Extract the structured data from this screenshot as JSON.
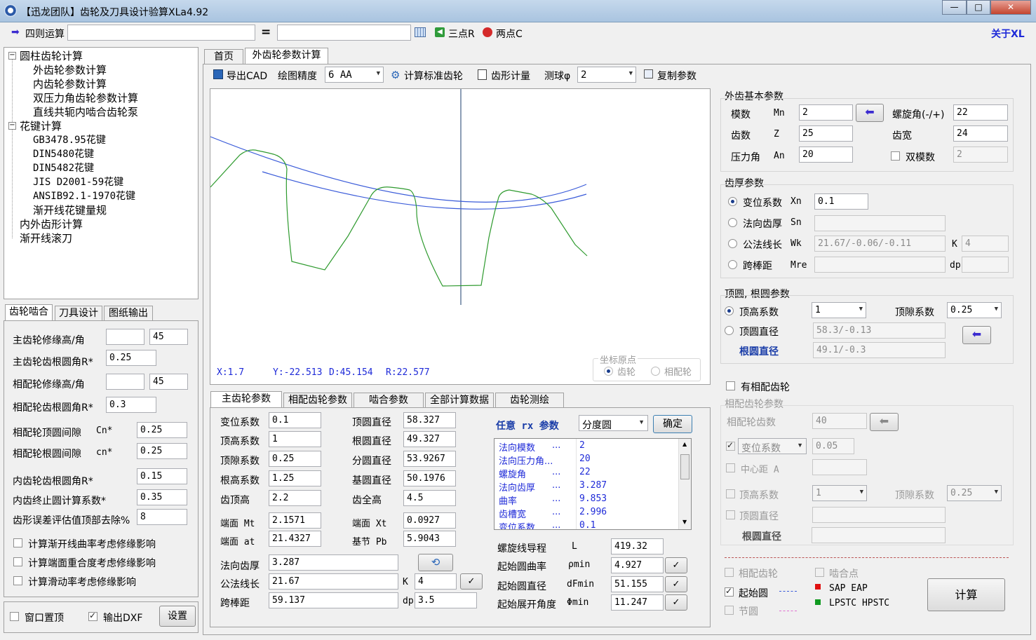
{
  "window": {
    "title": "【迅龙团队】齿轮及刀具设计验算XLa4.92",
    "min": "—",
    "max": "□",
    "close": "✕"
  },
  "topbar": {
    "calc_label": "四则运算",
    "calc_value": "",
    "equals": "=",
    "result_value": "",
    "three_point": "三点R",
    "two_point": "两点C",
    "about": "关于XL"
  },
  "tree": {
    "items": [
      "圆柱齿轮计算",
      "外齿轮参数计算",
      "内齿轮参数计算",
      "双压力角齿轮参数计算",
      "直线共轭内啮合齿轮泵",
      "花键计算",
      "GB3478.95花键",
      "DIN5480花键",
      "DIN5482花键",
      "JIS D2001-59花键",
      "ANSIB92.1-1970花键",
      "渐开线花键量规",
      "内外齿形计算",
      "渐开线滚刀"
    ],
    "expand_minus": "−"
  },
  "left_tabs": {
    "t1": "齿轮啮合",
    "t2": "刀具设计",
    "t3": "图纸输出"
  },
  "left_form": {
    "main_mod_label": "主齿轮修缘高/角",
    "main_mod_h": "",
    "main_mod_a": "45",
    "main_root_label": "主齿轮齿根圆角R*",
    "main_root": "0.25",
    "mate_mod_label": "相配轮修缘高/角",
    "mate_mod_h": "",
    "mate_mod_a": "45",
    "mate_root_label": "相配轮齿根圆角R*",
    "mate_root": "0.3",
    "mate_tip_label": "相配轮顶圆间隙",
    "mate_tip_sym": "Cn*",
    "mate_tip": "0.25",
    "mate_rootc_label": "相配轮根圆间隙",
    "mate_rootc_sym": "cn*",
    "mate_rootc": "0.25",
    "inner_root_label": "内齿轮齿根圆角R*",
    "inner_root": "0.15",
    "inner_stop_label": "内齿终止圆计算系数*",
    "inner_stop": "0.35",
    "err_label": "齿形误差评估值顶部去除%",
    "err": "8",
    "cb1": "计算渐开线曲率考虑修缘影响",
    "cb2": "计算端面重合度考虑修缘影响",
    "cb3": "计算滑动率考虑修缘影响"
  },
  "bottom_left": {
    "topmost": "窗口置顶",
    "dxf": "输出DXF",
    "settings": "设置"
  },
  "main_tabs": {
    "home": "首页",
    "ext": "外齿轮参数计算"
  },
  "toolbar": {
    "export_cad": "导出CAD",
    "precision_label": "绘图精度",
    "precision_value": "6  AA",
    "calc_std": "计算标准齿轮",
    "profile": "齿形计量",
    "ball_label": "测球φ",
    "ball_value": "2",
    "copy": "复制参数"
  },
  "canvas": {
    "readout_x": "X:1.7",
    "readout_y": "Y:-22.513",
    "readout_d": "D:45.154",
    "readout_r": "R:22.577",
    "origin_label": "坐标原点",
    "origin_gear": "齿轮",
    "origin_mate": "相配轮"
  },
  "lower_tabs": {
    "t1": "主齿轮参数",
    "t2": "相配齿轮参数",
    "t3": "啮合参数",
    "t4": "全部计算数据",
    "t5": "齿轮测绘"
  },
  "main_params": {
    "xn_label": "变位系数",
    "xn": "0.1",
    "ha_label": "顶高系数",
    "ha": "1",
    "c_label": "顶隙系数",
    "c": "0.25",
    "hf_label": "根高系数",
    "hf": "1.25",
    "h_top_label": "齿顶高",
    "h_top": "2.2",
    "mt_label": "端面  Mt",
    "mt": "2.1571",
    "at_label": "端面  at",
    "at": "21.4327",
    "da_label": "顶圆直径",
    "da": "58.327",
    "df_label": "根圆直径",
    "df": "49.327",
    "d_label": "分圆直径",
    "d": "53.9267",
    "db_label": "基圆直径",
    "db": "50.1976",
    "h_label": "齿全高",
    "h": "4.5",
    "xt_label": "端面  Xt",
    "xt": "0.0927",
    "pb_label": "基节  Pb",
    "pb": "5.9043",
    "sn_label": "法向齿厚",
    "sn": "3.287",
    "wk_label": "公法线长",
    "wk": "21.67",
    "k_label": "K",
    "k": "4",
    "mr_label": "跨棒距",
    "mr": "59.137",
    "dp_label": "dp",
    "dp": "3.5"
  },
  "any_rx": {
    "label": "任意 rx 参数",
    "select": "分度圆",
    "ok": "确定",
    "rows": [
      {
        "k": "法向模数",
        "dots": "...",
        "v": "2"
      },
      {
        "k": "法向压力角...",
        "dots": "",
        "v": "20"
      },
      {
        "k": "螺旋角",
        "dots": "...",
        "v": "22"
      },
      {
        "k": "法向齿厚",
        "dots": "...",
        "v": "3.287"
      },
      {
        "k": "曲率",
        "dots": "...",
        "v": "9.853"
      },
      {
        "k": "齿槽宽",
        "dots": "...",
        "v": "2.996"
      },
      {
        "k": "变位系数",
        "dots": "...",
        "v": "0.1"
      }
    ]
  },
  "helix": {
    "lead_label": "螺旋线导程",
    "lead_sym": "L",
    "lead": "419.32",
    "rmin_label": "起始圆曲率",
    "rmin_sym": "ρmin",
    "rmin": "4.927",
    "dfmin_label": "起始圆直径",
    "dfmin_sym": "dFmin",
    "dfmin": "51.155",
    "phimin_label": "起始展开角度",
    "phimin_sym": "Φmin",
    "phimin": "11.247",
    "check": "✓"
  },
  "right": {
    "basic_title": "外齿基本参数",
    "mn_label": "模数",
    "mn_sym": "Mn",
    "mn": "2",
    "z_label": "齿数",
    "z_sym": "Z",
    "z": "25",
    "an_label": "压力角",
    "an_sym": "An",
    "an": "20",
    "beta_label": "螺旋角(-/+)",
    "beta": "22",
    "b_label": "齿宽",
    "b": "24",
    "dual_label": "双模数",
    "dual": "2",
    "thick_title": "齿厚参数",
    "xn_label": "变位系数",
    "xn_sym": "Xn",
    "xn": "0.1",
    "sn_label": "法向齿厚",
    "sn_sym": "Sn",
    "sn": "",
    "wk_label": "公法线长",
    "wk_sym": "Wk",
    "wk": "21.67/-0.06/-0.11",
    "k_sym": "K",
    "k": "4",
    "mr_label": "跨棒距",
    "mr_sym": "Mre",
    "mr": "",
    "dp_sym": "dp",
    "dp": "",
    "tip_title": "顶圆, 根圆参数",
    "ha_label": "顶高系数",
    "ha": "1",
    "c_label": "顶隙系数",
    "c": "0.25",
    "da_label": "顶圆直径",
    "da": "58.3/-0.13",
    "df_label": "根圆直径",
    "df": "49.1/-0.3",
    "has_mate": "有相配齿轮",
    "mate_title": "相配齿轮参数",
    "mate_z_label": "相配轮齿数",
    "mate_z": "40",
    "mate_xn_label": "变位系数",
    "mate_xn": "0.05",
    "mate_a_label": "中心距  A",
    "mate_a": "",
    "mate_ha_label": "顶高系数",
    "mate_ha": "1",
    "mate_c_label": "顶隙系数",
    "mate_c": "0.25",
    "mate_da_label": "顶圆直径",
    "mate_da": "",
    "mate_df_label": "根圆直径",
    "mate_df": "",
    "leg_mate": "相配齿轮",
    "leg_mesh": "啮合点",
    "leg_start": "起始圆",
    "leg_pitch": "节圆",
    "leg_sap": "SAP EAP",
    "leg_lpstc": "LPSTC HPSTC",
    "calc": "计算"
  },
  "colors": {
    "gear_line": "#2e9a2e",
    "circle_line": "#3a5bd9",
    "axis": "#1a3d6c"
  }
}
